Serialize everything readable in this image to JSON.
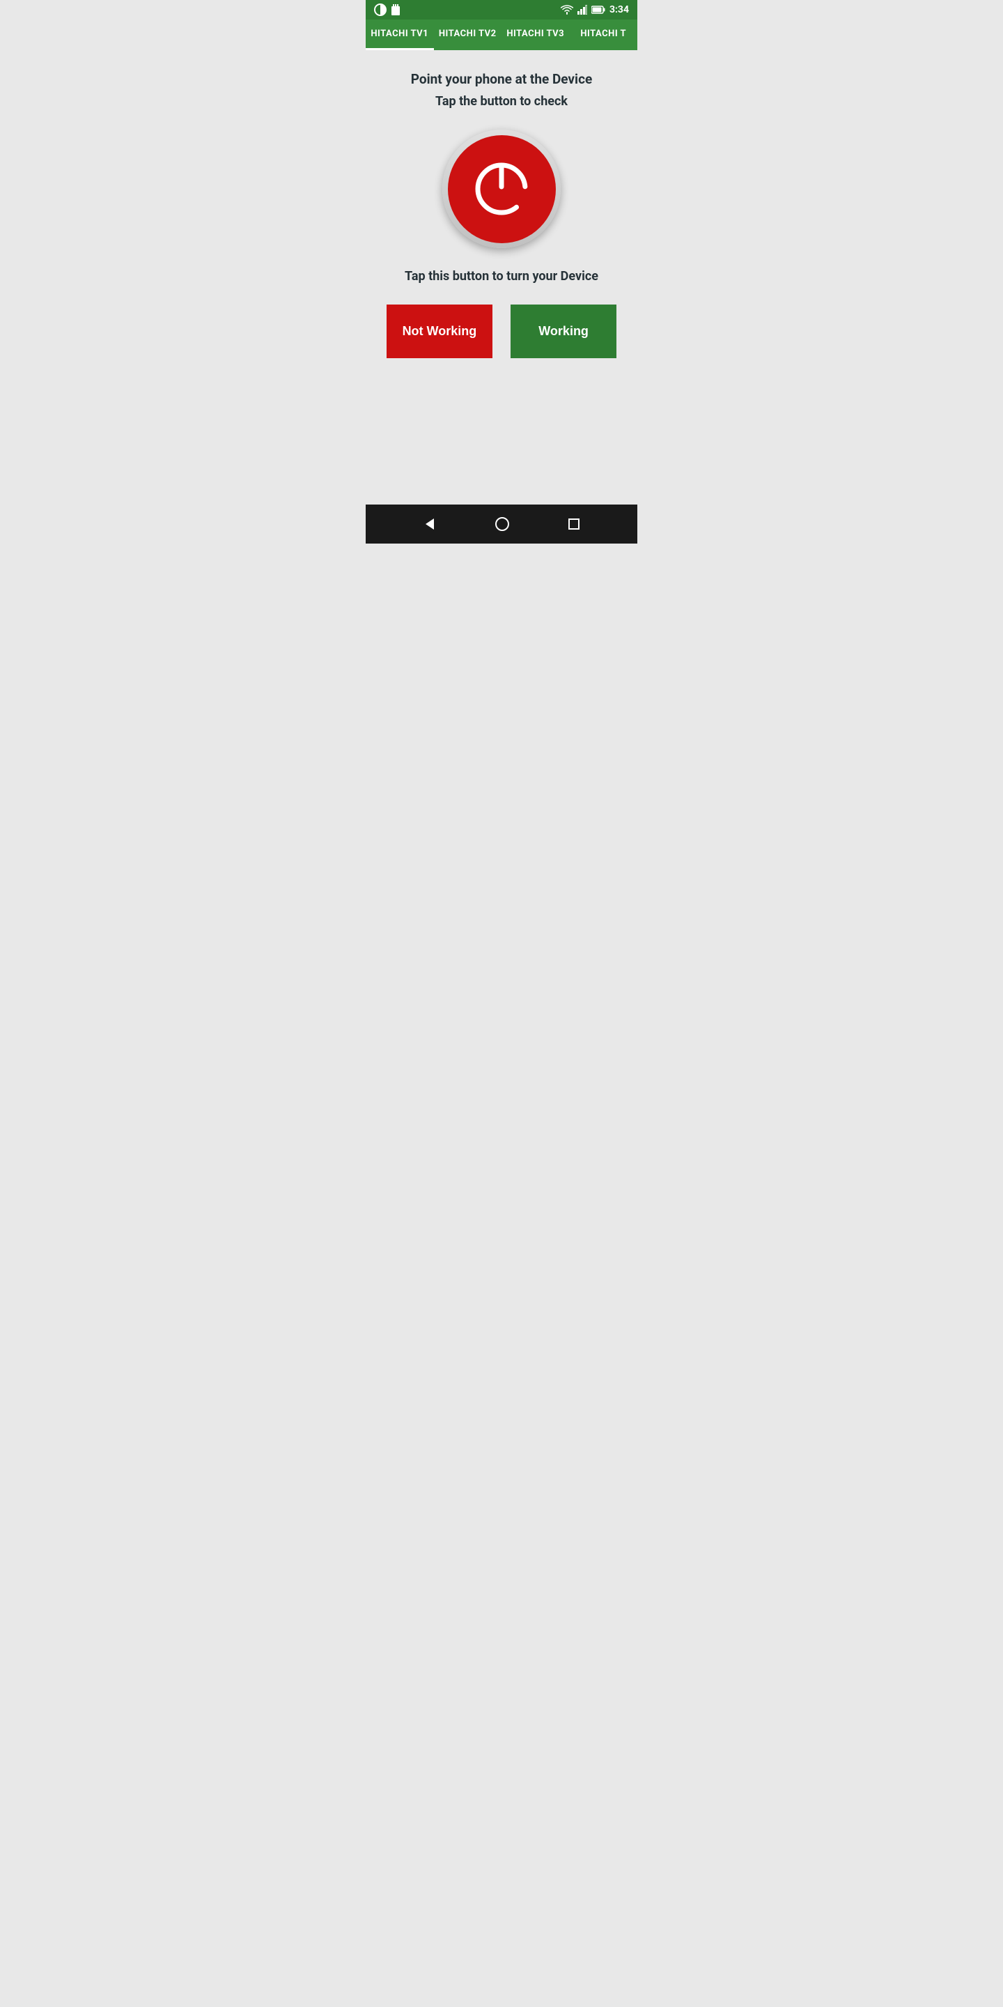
{
  "statusBar": {
    "time": "3:34"
  },
  "tabs": [
    {
      "label": "HITACHI TV1",
      "active": true
    },
    {
      "label": "HITACHI TV2",
      "active": false
    },
    {
      "label": "HITACHI TV3",
      "active": false
    },
    {
      "label": "HITACHI T",
      "active": false
    }
  ],
  "main": {
    "instructionTitle": "Point your phone at the Device",
    "instructionSub": "Tap the button to check",
    "tapInstruction": "Tap this button to turn your Device",
    "notWorkingLabel": "Not Working",
    "workingLabel": "Working"
  },
  "colors": {
    "notWorking": "#cc1111",
    "working": "#2e7d32",
    "tabBg": "#388e3c",
    "statusBg": "#2e7d32"
  }
}
